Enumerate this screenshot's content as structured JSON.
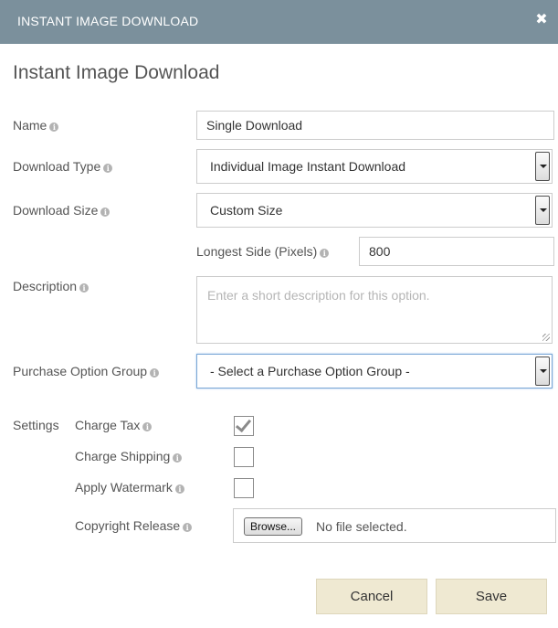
{
  "dialog": {
    "title": "INSTANT IMAGE DOWNLOAD",
    "close_glyph": "✖",
    "heading": "Instant Image Download"
  },
  "info_glyph": "i",
  "icons": {
    "info": "info-icon",
    "close": "close-icon",
    "checkmark": "checkmark-icon",
    "dropdown": "chevron-down-icon",
    "resize": "resize-grip-icon"
  },
  "colors": {
    "titlebar": "#7b909c",
    "button_bg": "#efe9d2",
    "text": "#555555"
  },
  "form": {
    "name": {
      "label": "Name",
      "value": "Single Download"
    },
    "download_type": {
      "label": "Download Type",
      "selected": "Individual Image Instant Download"
    },
    "download_size": {
      "label": "Download Size",
      "selected": "Custom Size"
    },
    "longest_side": {
      "label": "Longest Side (Pixels)",
      "value": "800"
    },
    "description": {
      "label": "Description",
      "placeholder": "Enter a short description for this option."
    },
    "purchase_group": {
      "label": "Purchase Option Group",
      "selected": "- Select a Purchase Option Group -"
    }
  },
  "settings": {
    "label": "Settings",
    "charge_tax": {
      "label": "Charge Tax",
      "checked": true
    },
    "charge_shipping": {
      "label": "Charge Shipping",
      "checked": false
    },
    "apply_watermark": {
      "label": "Apply Watermark",
      "checked": false
    },
    "copyright_release": {
      "label": "Copyright Release",
      "browse_label": "Browse...",
      "status": "No file selected."
    }
  },
  "buttons": {
    "cancel": "Cancel",
    "save": "Save"
  }
}
